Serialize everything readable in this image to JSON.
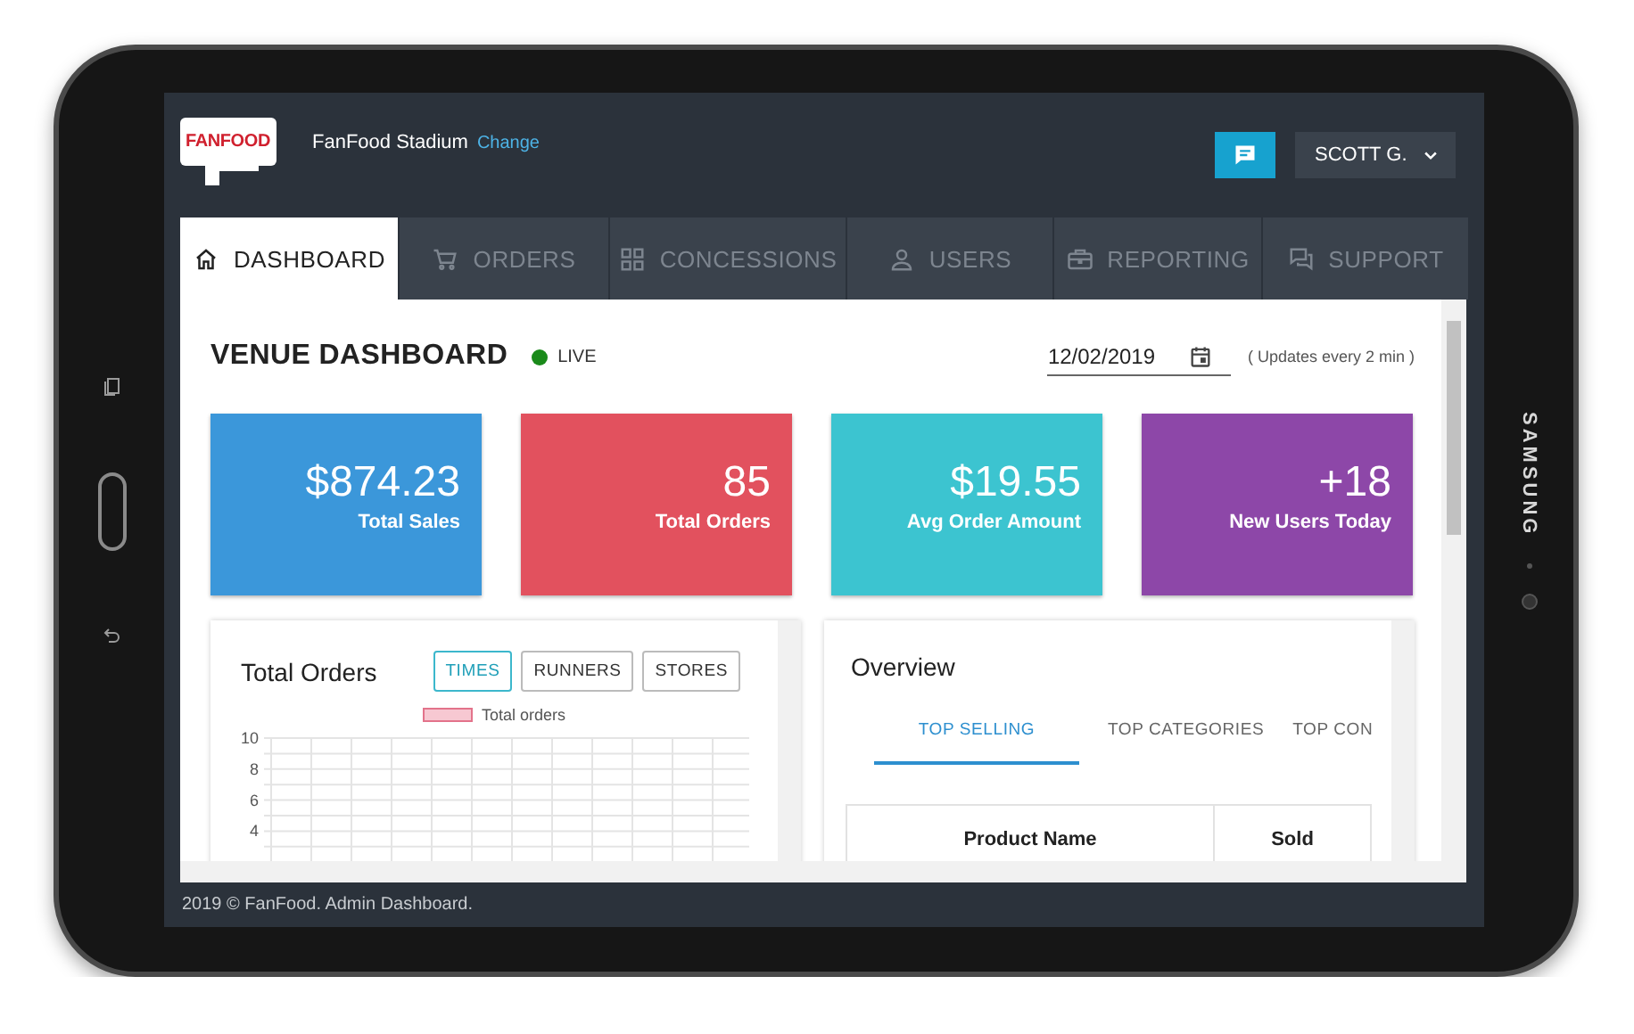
{
  "device": {
    "brand": "SAMSUNG"
  },
  "header": {
    "logo": "FANFOOD",
    "venue": "FanFood Stadium",
    "change_link": "Change",
    "user": "SCOTT G."
  },
  "tabs": [
    {
      "label": "DASHBOARD",
      "selected": true
    },
    {
      "label": "ORDERS",
      "selected": false
    },
    {
      "label": "CONCESSIONS",
      "selected": false
    },
    {
      "label": "USERS",
      "selected": false
    },
    {
      "label": "REPORTING",
      "selected": false
    },
    {
      "label": "SUPPORT",
      "selected": false
    }
  ],
  "dashboard": {
    "title": "VENUE DASHBOARD",
    "status": {
      "label": "LIVE",
      "live": true
    },
    "date": "12/02/2019",
    "update_note": "( Updates every 2 min )"
  },
  "stats": [
    {
      "value": "$874.23",
      "label": "Total Sales",
      "color": "#3b97da"
    },
    {
      "value": "85",
      "label": "Total Orders",
      "color": "#e2515e"
    },
    {
      "value": "$19.55",
      "label": "Avg Order Amount",
      "color": "#3cc4d0"
    },
    {
      "value": "+18",
      "label": "New Users Today",
      "color": "#8d47a8"
    }
  ],
  "orders_panel": {
    "title": "Total Orders",
    "filters": [
      {
        "label": "TIMES",
        "selected": true
      },
      {
        "label": "RUNNERS",
        "selected": false
      },
      {
        "label": "STORES",
        "selected": false
      }
    ],
    "chart_data": {
      "type": "bar",
      "grid": true,
      "ylim": [
        0,
        10
      ],
      "yticks": [
        4,
        6,
        8,
        10
      ],
      "series": [
        {
          "name": "Total orders",
          "color": "#f7c8d2"
        }
      ]
    }
  },
  "overview": {
    "title": "Overview",
    "tabs": [
      {
        "label": "TOP SELLING",
        "selected": true
      },
      {
        "label": "TOP CATEGORIES",
        "selected": false
      },
      {
        "label": "TOP CON",
        "selected": false
      }
    ],
    "table": {
      "columns": [
        "Product Name",
        "Sold"
      ]
    }
  },
  "footer": "2019 © FanFood. Admin Dashboard."
}
